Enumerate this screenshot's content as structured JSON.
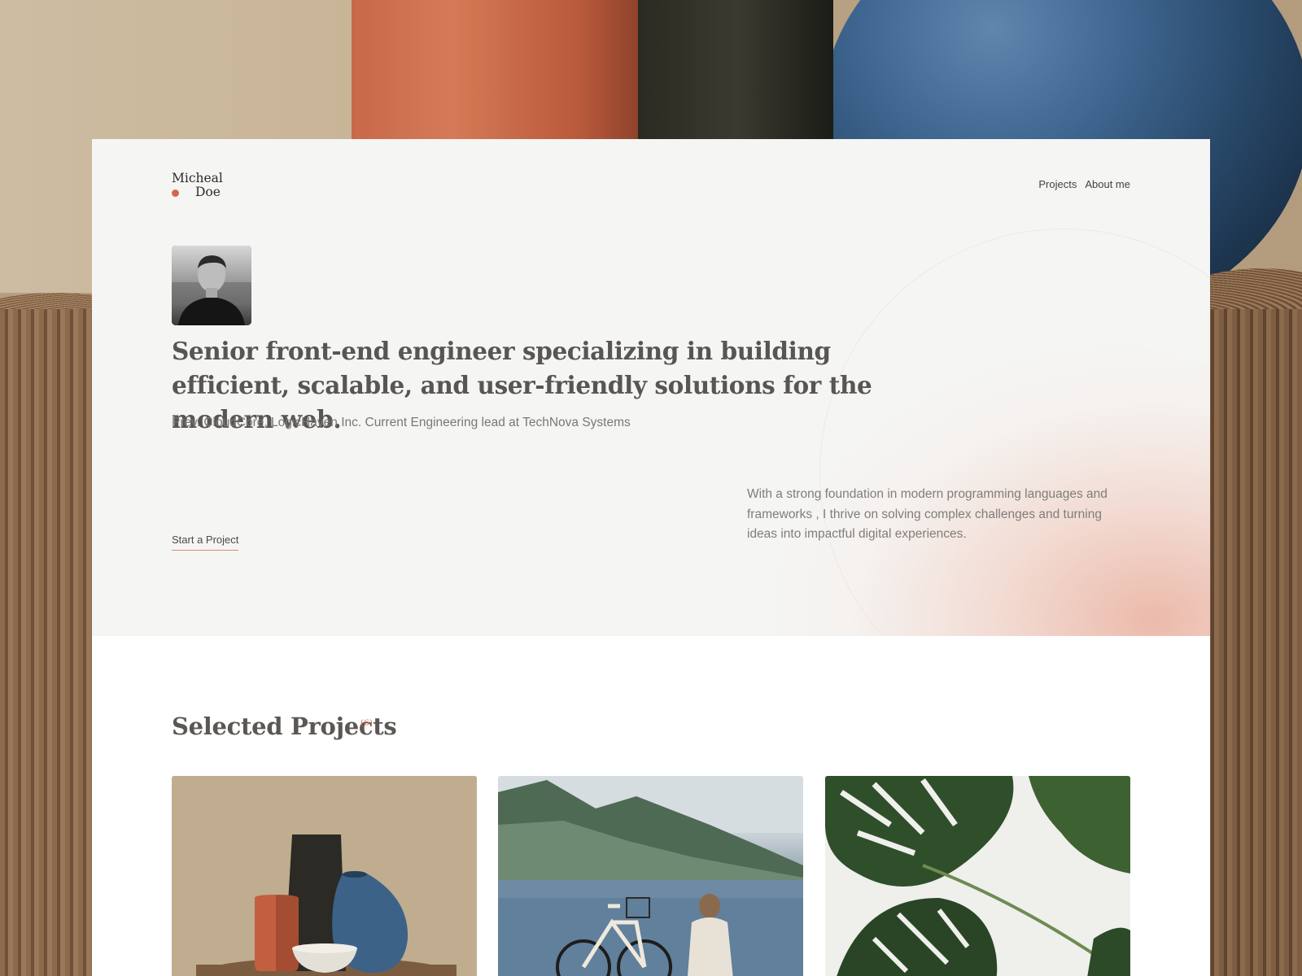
{
  "brand": {
    "first": "Micheal",
    "last": "Doe",
    "accent": "#d0694a"
  },
  "nav": {
    "items": [
      "Projects",
      "About me"
    ]
  },
  "hero": {
    "headline": "Senior front-end engineer specializing in building efficient, scalable, and user-friendly solutions for the modern web.",
    "subline": "Prev. CloudCore, LogicHaven Inc. Current Engineering lead at TechNova Systems",
    "cta_label": "Start a Project",
    "intro": "With a strong foundation in modern programming languages and frameworks , I thrive on solving complex challenges and turning ideas into impactful digital experiences."
  },
  "projects": {
    "title": "Selected Projects",
    "count": "(6)"
  },
  "colors": {
    "hero_bg": "#f5f5f4",
    "glow": "#eab09e",
    "text": "#585552"
  }
}
